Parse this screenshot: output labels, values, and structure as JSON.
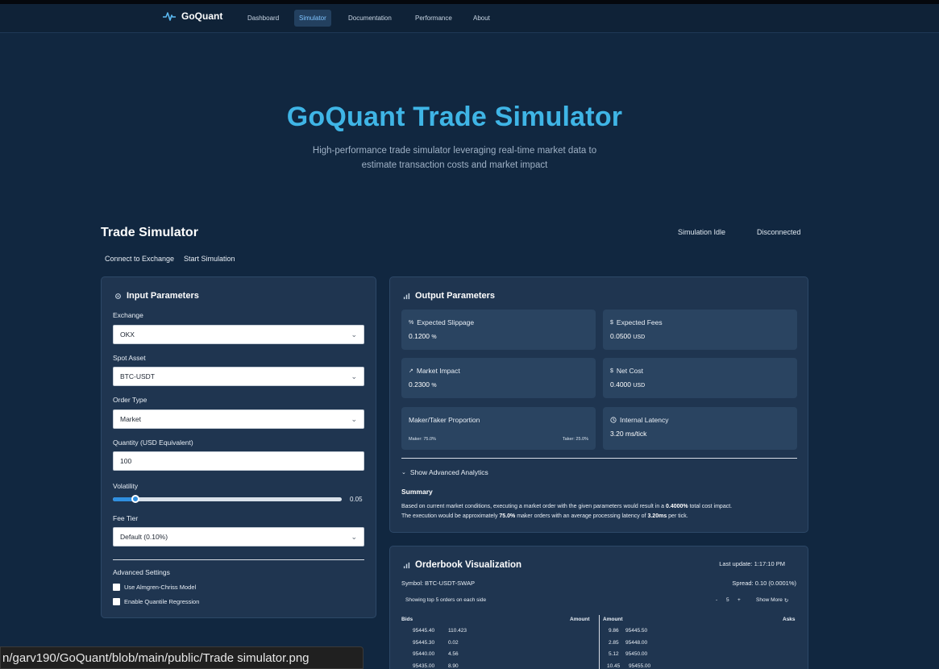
{
  "nav": {
    "brand": "GoQuant",
    "links": [
      "Dashboard",
      "Simulator",
      "Documentation",
      "Performance",
      "About"
    ],
    "active": "Simulator"
  },
  "hero": {
    "title": "GoQuant Trade Simulator",
    "subtitle_line1": "High-performance trade simulator leveraging real-time market data to",
    "subtitle_line2": "estimate transaction costs and market impact"
  },
  "simulator": {
    "title": "Trade Simulator",
    "status_sim": "Simulation Idle",
    "status_conn": "Disconnected",
    "connect_label": "Connect to Exchange",
    "start_label": "Start Simulation"
  },
  "input": {
    "title": "Input Parameters",
    "exchange_label": "Exchange",
    "exchange_value": "OKX",
    "asset_label": "Spot Asset",
    "asset_value": "BTC-USDT",
    "order_type_label": "Order Type",
    "order_type_value": "Market",
    "quantity_label": "Quantity (USD Equivalent)",
    "quantity_value": "100",
    "volatility_label": "Volatility",
    "volatility_value": "0.05",
    "volatility_fraction": 0.1,
    "fee_label": "Fee Tier",
    "fee_value": "Default (0.10%)",
    "advanced_label": "Advanced Settings",
    "opt_almgren": "Use Almgren-Chriss Model",
    "opt_quantile": "Enable Quantile Regression"
  },
  "output": {
    "title": "Output Parameters",
    "slippage_label": "Expected Slippage",
    "slippage_value": "0.1200",
    "fees_label": "Expected Fees",
    "fees_value": "0.0500",
    "impact_label": "Market Impact",
    "impact_value": "0.2300",
    "net_label": "Net Cost",
    "net_value": "0.4000",
    "percent_unit": "%",
    "usd_unit": "USD",
    "maker_taker_label": "Maker/Taker Proportion",
    "maker_text": "Maker: 75.0%",
    "taker_text": "Taker: 25.0%",
    "latency_label": "Internal Latency",
    "latency_value": "3.20 ms/tick",
    "advanced_toggle": "Show Advanced Analytics",
    "summary_title": "Summary",
    "summary_part1": "Based on current market conditions, executing a market order with the given parameters would result in a ",
    "summary_cost": "0.4000%",
    "summary_part2": " total cost impact.",
    "summary_part3": "The execution would be approximately ",
    "summary_maker": "75.0%",
    "summary_part4": " maker orders with an average processing latency of ",
    "summary_latency": "3.20ms",
    "summary_part5": " per tick."
  },
  "orderbook": {
    "title": "Orderbook Visualization",
    "last_update": "Last update: 1:17:10 PM",
    "symbol": "Symbol: BTC-USDT-SWAP",
    "spread": "Spread: 0.10 (0.0001%)",
    "showing": "Showing top 5 orders on each side",
    "minus": "-",
    "count": "5",
    "plus": "+",
    "show_more": "Show More",
    "bids_header": "Bids",
    "amount_header": "Amount",
    "amount_header2": "Amount",
    "asks_header": "Asks",
    "bids": [
      {
        "price": "95445.40",
        "amount": "110.423"
      },
      {
        "price": "95445.30",
        "amount": "0.02"
      },
      {
        "price": "95440.00",
        "amount": "4.56"
      },
      {
        "price": "95435.00",
        "amount": "8.90"
      }
    ],
    "asks": [
      {
        "amount": "9.86",
        "price": "95445.50"
      },
      {
        "amount": "2.85",
        "price": "95448.00"
      },
      {
        "amount": "5.12",
        "price": "95450.00"
      },
      {
        "amount": "10.45",
        "price": "95455.00"
      }
    ]
  },
  "tooltip_url": "n/garv190/GoQuant/blob/main/public/Trade simulator.png"
}
